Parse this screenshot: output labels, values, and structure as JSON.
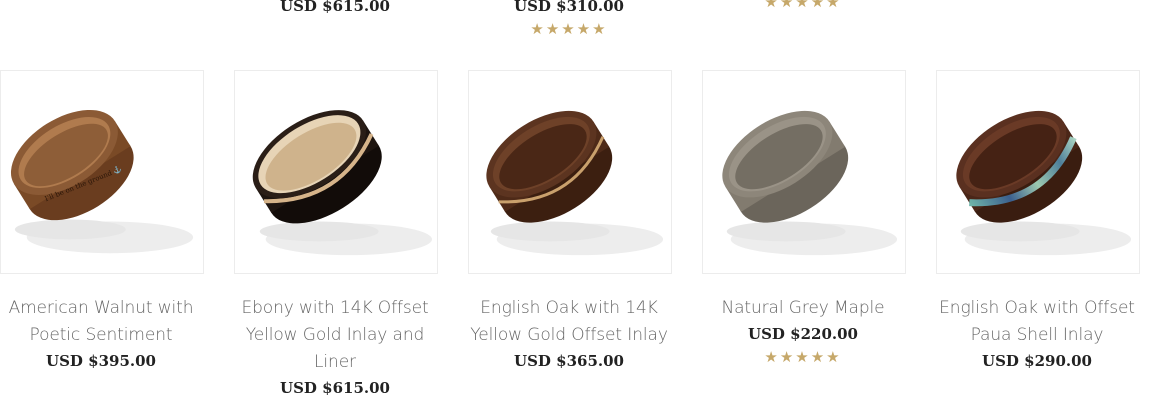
{
  "top_row": [
    {
      "price": "USD $615.00"
    },
    {
      "price": "USD $310.00",
      "rating_stars": 5
    },
    {
      "rating_stars": 5
    }
  ],
  "products": [
    {
      "title_line1": "American Walnut with",
      "title_line2": "Poetic Sentiment",
      "title_line3": "",
      "price": "USD $395.00",
      "wood_color": "#7a4a26",
      "inner_color": "#8b5a35",
      "inlay": "engraving"
    },
    {
      "title_line1": "Ebony with 14K Offset",
      "title_line2": "Yellow Gold Inlay and",
      "title_line3": "Liner",
      "price": "USD $615.00",
      "wood_color": "#1e1510",
      "inner_color": "#d9c2a0",
      "inlay": "gold"
    },
    {
      "title_line1": "English Oak with 14K",
      "title_line2": "Yellow Gold Offset Inlay",
      "title_line3": "",
      "price": "USD $365.00",
      "wood_color": "#4e2a18",
      "inner_color": "#5c3420",
      "inlay": "gold"
    },
    {
      "title_line1": "Natural Grey Maple",
      "title_line2": "",
      "title_line3": "",
      "price": "USD $220.00",
      "rating_stars": 5,
      "wood_color": "#827b6f",
      "inner_color": "#8d867a",
      "inlay": "none"
    },
    {
      "title_line1": "English Oak with Offset",
      "title_line2": "Paua Shell Inlay",
      "title_line3": "",
      "price": "USD $290.00",
      "wood_color": "#4a2618",
      "inner_color": "#5a3020",
      "inlay": "paua"
    }
  ],
  "star_glyph": "★★★★★",
  "star_color": "#c6a86a"
}
